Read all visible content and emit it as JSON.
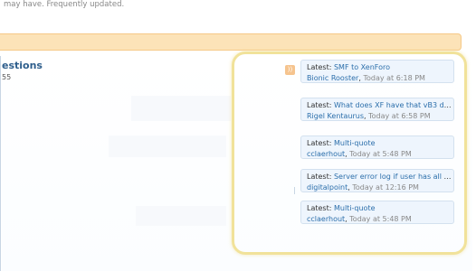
{
  "header": {
    "tagline": "may have. Frequently updated."
  },
  "section": {
    "title": "estions",
    "subtitle": "55"
  },
  "latest_posts": [
    {
      "prefix": "Latest:",
      "title": "SMF to XenForo",
      "user": "Bionic Rooster",
      "time": "Today at 6:18 PM"
    },
    {
      "prefix": "Latest:",
      "title": "What does XF have that vB3 do...",
      "user": "Rigel Kentaurus",
      "time": "Today at 6:58 PM"
    },
    {
      "prefix": "Latest:",
      "title": "Multi-quote",
      "user": "cclaerhout",
      "time": "Today at 5:48 PM"
    },
    {
      "prefix": "Latest:",
      "title": "Server error log if user has all p...",
      "user": "digitalpoint",
      "time": "Today at 12:16 PM"
    },
    {
      "prefix": "Latest:",
      "title": "Multi-quote",
      "user": "cclaerhout",
      "time": "Today at 5:48 PM"
    }
  ],
  "colors": {
    "highlight_border": "#f1e29a",
    "card_background": "#eef5fd",
    "link": "#2c6fab",
    "section_title": "#2e5e8c"
  },
  "icons": {
    "feed": "rss-icon"
  }
}
